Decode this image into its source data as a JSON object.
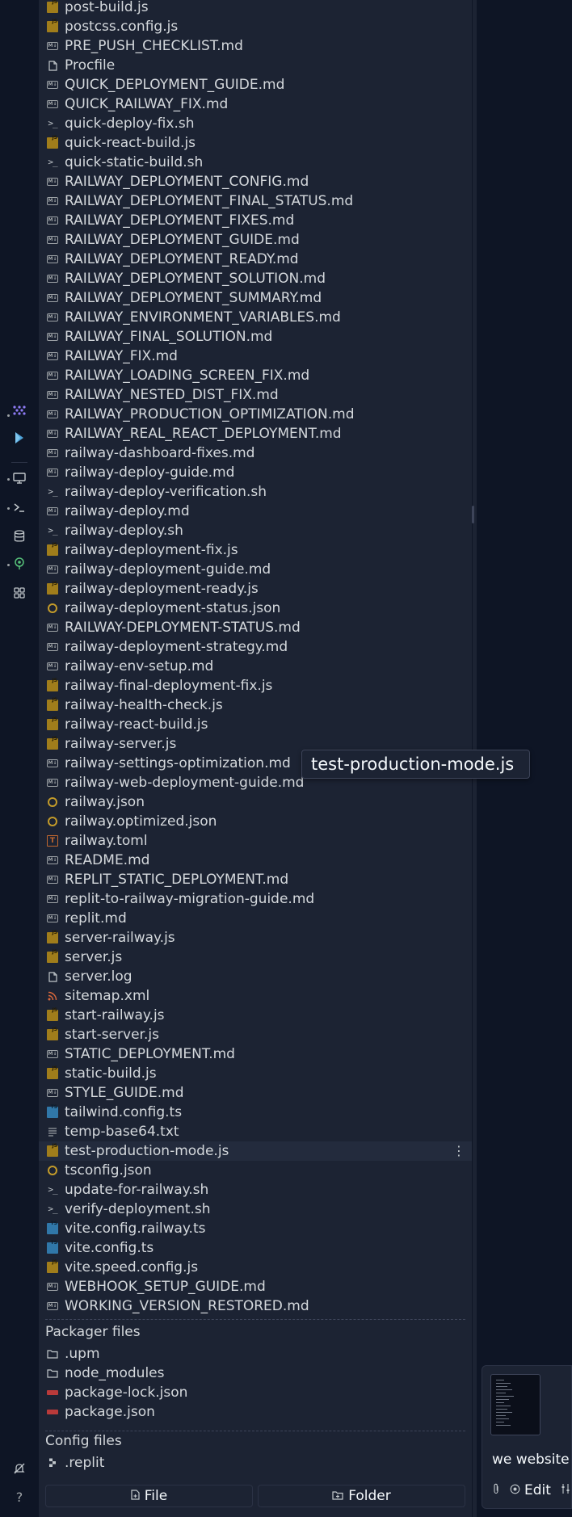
{
  "files": [
    {
      "name": "post-build.js",
      "icon": "js-icon"
    },
    {
      "name": "postcss.config.js",
      "icon": "js-icon"
    },
    {
      "name": "PRE_PUSH_CHECKLIST.md",
      "icon": "markdown-icon"
    },
    {
      "name": "Procfile",
      "icon": "file-icon"
    },
    {
      "name": "QUICK_DEPLOYMENT_GUIDE.md",
      "icon": "markdown-icon"
    },
    {
      "name": "QUICK_RAILWAY_FIX.md",
      "icon": "markdown-icon"
    },
    {
      "name": "quick-deploy-fix.sh",
      "icon": "shell-icon"
    },
    {
      "name": "quick-react-build.js",
      "icon": "js-icon"
    },
    {
      "name": "quick-static-build.sh",
      "icon": "shell-icon"
    },
    {
      "name": "RAILWAY_DEPLOYMENT_CONFIG.md",
      "icon": "markdown-icon"
    },
    {
      "name": "RAILWAY_DEPLOYMENT_FINAL_STATUS.md",
      "icon": "markdown-icon"
    },
    {
      "name": "RAILWAY_DEPLOYMENT_FIXES.md",
      "icon": "markdown-icon"
    },
    {
      "name": "RAILWAY_DEPLOYMENT_GUIDE.md",
      "icon": "markdown-icon"
    },
    {
      "name": "RAILWAY_DEPLOYMENT_READY.md",
      "icon": "markdown-icon"
    },
    {
      "name": "RAILWAY_DEPLOYMENT_SOLUTION.md",
      "icon": "markdown-icon"
    },
    {
      "name": "RAILWAY_DEPLOYMENT_SUMMARY.md",
      "icon": "markdown-icon"
    },
    {
      "name": "RAILWAY_ENVIRONMENT_VARIABLES.md",
      "icon": "markdown-icon"
    },
    {
      "name": "RAILWAY_FINAL_SOLUTION.md",
      "icon": "markdown-icon"
    },
    {
      "name": "RAILWAY_FIX.md",
      "icon": "markdown-icon"
    },
    {
      "name": "RAILWAY_LOADING_SCREEN_FIX.md",
      "icon": "markdown-icon"
    },
    {
      "name": "RAILWAY_NESTED_DIST_FIX.md",
      "icon": "markdown-icon"
    },
    {
      "name": "RAILWAY_PRODUCTION_OPTIMIZATION.md",
      "icon": "markdown-icon"
    },
    {
      "name": "RAILWAY_REAL_REACT_DEPLOYMENT.md",
      "icon": "markdown-icon"
    },
    {
      "name": "railway-dashboard-fixes.md",
      "icon": "markdown-icon"
    },
    {
      "name": "railway-deploy-guide.md",
      "icon": "markdown-icon"
    },
    {
      "name": "railway-deploy-verification.sh",
      "icon": "shell-icon"
    },
    {
      "name": "railway-deploy.md",
      "icon": "markdown-icon"
    },
    {
      "name": "railway-deploy.sh",
      "icon": "shell-icon"
    },
    {
      "name": "railway-deployment-fix.js",
      "icon": "js-icon"
    },
    {
      "name": "railway-deployment-guide.md",
      "icon": "markdown-icon"
    },
    {
      "name": "railway-deployment-ready.js",
      "icon": "js-icon"
    },
    {
      "name": "railway-deployment-status.json",
      "icon": "json-icon"
    },
    {
      "name": "RAILWAY-DEPLOYMENT-STATUS.md",
      "icon": "markdown-icon"
    },
    {
      "name": "railway-deployment-strategy.md",
      "icon": "markdown-icon"
    },
    {
      "name": "railway-env-setup.md",
      "icon": "markdown-icon"
    },
    {
      "name": "railway-final-deployment-fix.js",
      "icon": "js-icon"
    },
    {
      "name": "railway-health-check.js",
      "icon": "js-icon"
    },
    {
      "name": "railway-react-build.js",
      "icon": "js-icon"
    },
    {
      "name": "railway-server.js",
      "icon": "js-icon"
    },
    {
      "name": "railway-settings-optimization.md",
      "icon": "markdown-icon"
    },
    {
      "name": "railway-web-deployment-guide.md",
      "icon": "markdown-icon"
    },
    {
      "name": "railway.json",
      "icon": "json-icon"
    },
    {
      "name": "railway.optimized.json",
      "icon": "json-icon"
    },
    {
      "name": "railway.toml",
      "icon": "toml-icon"
    },
    {
      "name": "README.md",
      "icon": "markdown-icon"
    },
    {
      "name": "REPLIT_STATIC_DEPLOYMENT.md",
      "icon": "markdown-icon"
    },
    {
      "name": "replit-to-railway-migration-guide.md",
      "icon": "markdown-icon"
    },
    {
      "name": "replit.md",
      "icon": "markdown-icon"
    },
    {
      "name": "server-railway.js",
      "icon": "js-icon"
    },
    {
      "name": "server.js",
      "icon": "js-icon"
    },
    {
      "name": "server.log",
      "icon": "file-icon"
    },
    {
      "name": "sitemap.xml",
      "icon": "rss-icon"
    },
    {
      "name": "start-railway.js",
      "icon": "js-icon"
    },
    {
      "name": "start-server.js",
      "icon": "js-icon"
    },
    {
      "name": "STATIC_DEPLOYMENT.md",
      "icon": "markdown-icon"
    },
    {
      "name": "static-build.js",
      "icon": "js-icon"
    },
    {
      "name": "STYLE_GUIDE.md",
      "icon": "markdown-icon"
    },
    {
      "name": "tailwind.config.ts",
      "icon": "ts-icon"
    },
    {
      "name": "temp-base64.txt",
      "icon": "text-icon"
    },
    {
      "name": "test-production-mode.js",
      "icon": "js-icon",
      "selected": true
    },
    {
      "name": "tsconfig.json",
      "icon": "json-icon"
    },
    {
      "name": "update-for-railway.sh",
      "icon": "shell-icon"
    },
    {
      "name": "verify-deployment.sh",
      "icon": "shell-icon"
    },
    {
      "name": "vite.config.railway.ts",
      "icon": "ts-icon"
    },
    {
      "name": "vite.config.ts",
      "icon": "ts-icon"
    },
    {
      "name": "vite.speed.config.js",
      "icon": "js-icon"
    },
    {
      "name": "WEBHOOK_SETUP_GUIDE.md",
      "icon": "markdown-icon"
    },
    {
      "name": "WORKING_VERSION_RESTORED.md",
      "icon": "markdown-icon"
    }
  ],
  "packager": {
    "title": "Packager files",
    "items": [
      {
        "name": ".upm",
        "icon": "folder-icon"
      },
      {
        "name": "node_modules",
        "icon": "folder-icon"
      },
      {
        "name": "package-lock.json",
        "icon": "npm-icon"
      },
      {
        "name": "package.json",
        "icon": "npm-icon"
      }
    ]
  },
  "config": {
    "title": "Config files",
    "items": [
      {
        "name": ".replit",
        "icon": "replit-icon"
      }
    ]
  },
  "buttons": {
    "file": "File",
    "folder": "Folder"
  },
  "tooltip": "test-production-mode.js",
  "chat": {
    "text": "we website i",
    "edit_label": "Edit"
  },
  "colors": {
    "background": "#0e1525",
    "panel": "#1c2333",
    "js": "#a07d1b",
    "ts": "#3077a8",
    "json": "#c39b2a",
    "toml": "#c1672f",
    "rss": "#d9683b",
    "npm": "#b93a3a",
    "accent_purple": "#8f7cf7",
    "accent_green": "#57c27a"
  }
}
